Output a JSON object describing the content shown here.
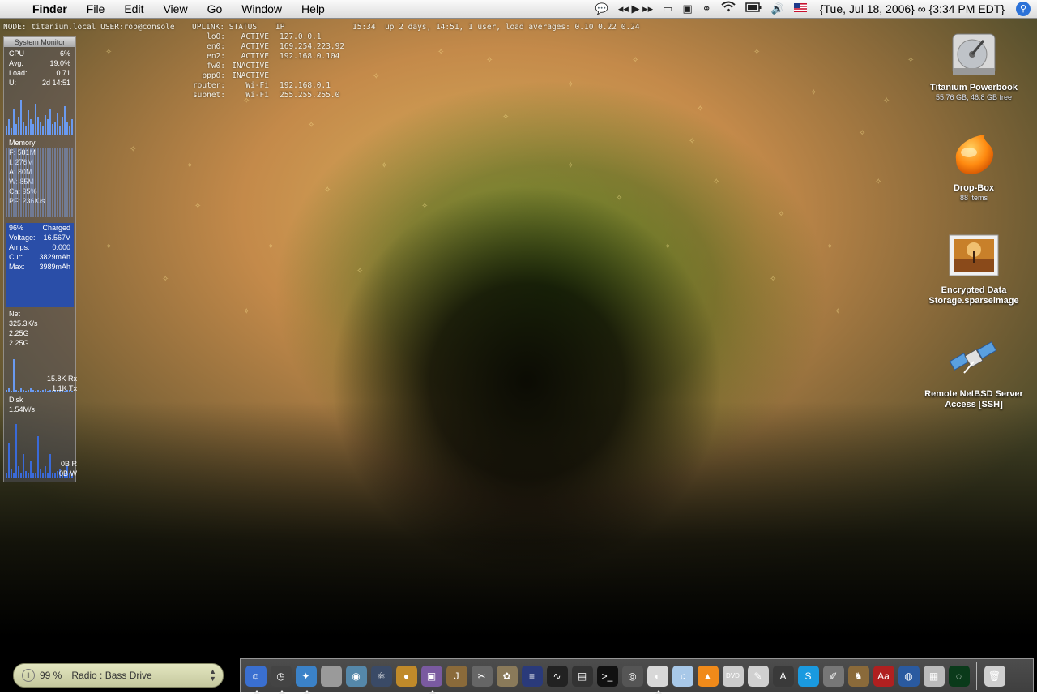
{
  "menubar": {
    "apple_icon": "apple-logo-icon",
    "app_name": "Finder",
    "menus": [
      "File",
      "Edit",
      "View",
      "Go",
      "Window",
      "Help"
    ],
    "status_icons": [
      "chat-icon",
      "media-controls-icon",
      "screen-icon",
      "display-icon",
      "binoculars-icon",
      "wifi-icon",
      "battery-icon",
      "volume-icon",
      "flag-icon"
    ],
    "media_controls": "◂◂ ▶ ▸▸",
    "clock": "{Tue, Jul 18, 2006} ∞ {3:34 PM EDT}"
  },
  "console": {
    "node_line": "NODE: titanium.local USER:rob@console",
    "uplink_header": "UPLINK: STATUS    IP",
    "uptime": "15:34  up 2 days, 14:51, 1 user, load averages: 0.10 0.22 0.24",
    "interfaces": [
      {
        "name": "lo0:",
        "status": "ACTIVE",
        "ip": "127.0.0.1"
      },
      {
        "name": "en0:",
        "status": "ACTIVE",
        "ip": "169.254.223.92"
      },
      {
        "name": "en2:",
        "status": "ACTIVE",
        "ip": "192.168.0.104"
      },
      {
        "name": "fw0:",
        "status": "INACTIVE",
        "ip": ""
      },
      {
        "name": "ppp0:",
        "status": "INACTIVE",
        "ip": ""
      },
      {
        "name": "router:",
        "status": "Wi-Fi",
        "ip": "192.168.0.1"
      },
      {
        "name": "subnet:",
        "status": "Wi-Fi",
        "ip": "255.255.255.0"
      }
    ]
  },
  "sysmon": {
    "title": "System Monitor",
    "cpu": [
      [
        "CPU",
        "6%"
      ],
      [
        "Avg:",
        "19.0%"
      ],
      [
        "Load:",
        "0.71"
      ],
      [
        "U:",
        "2d 14:51"
      ]
    ],
    "memory_title": "Memory",
    "memory": [
      "F: 581M",
      "I: 276M",
      "A: 80M",
      "W: 85M",
      "Ca: 95%",
      "PF: 236K/s"
    ],
    "battery_pct": "96%",
    "battery_state": "Charged",
    "battery": [
      [
        "Voltage:",
        "16.567V"
      ],
      [
        "Amps:",
        "0.000"
      ],
      [
        "Cur:",
        "3829mAh"
      ],
      [
        "Max:",
        "3989mAh"
      ]
    ],
    "net_title": "Net",
    "net": [
      "325.3K/s",
      "2.25G",
      "2.25G"
    ],
    "net_rx": "15.8K Rx",
    "net_tx": "1.1K Tx",
    "disk_title": "Disk",
    "disk_rate": "1.54M/s",
    "disk_read": "0B R",
    "disk_write": "0B W"
  },
  "desktop_icons": [
    {
      "label": "Titanium Powerbook",
      "sub": "55.76 GB, 46.8 GB free",
      "icon": "hard-drive-icon"
    },
    {
      "label": "Drop-Box",
      "sub": "88 items",
      "icon": "dropbox-folder-icon"
    },
    {
      "label": "Encrypted Data Storage.sparseimage",
      "sub": "",
      "icon": "disk-image-icon"
    },
    {
      "label": "Remote NetBSD Server Access [SSH]",
      "sub": "",
      "icon": "satellite-icon"
    }
  ],
  "radio": {
    "volume": "99 %",
    "station": "Radio : Bass Drive"
  },
  "dock": {
    "items": [
      {
        "name": "finder",
        "glyph": "☺",
        "color": "#3a6fd0",
        "running": true
      },
      {
        "name": "dashboard",
        "glyph": "◷",
        "color": "#444",
        "running": true
      },
      {
        "name": "safari",
        "glyph": "✦",
        "color": "#3b82c8",
        "running": true
      },
      {
        "name": "system-prefs",
        "glyph": "",
        "color": "#9a9a9a",
        "running": false
      },
      {
        "name": "eye",
        "glyph": "◉",
        "color": "#5588aa",
        "running": false
      },
      {
        "name": "atom",
        "glyph": "⚛",
        "color": "#3a4a66",
        "running": false
      },
      {
        "name": "burger",
        "glyph": "●",
        "color": "#c08a2a",
        "running": false
      },
      {
        "name": "photo",
        "glyph": "▣",
        "color": "#7a5aa0",
        "running": true
      },
      {
        "name": "journal",
        "glyph": "J",
        "color": "#8a6a3a",
        "running": false
      },
      {
        "name": "utility",
        "glyph": "✂",
        "color": "#666",
        "running": false
      },
      {
        "name": "gimp",
        "glyph": "✿",
        "color": "#8a7a5a",
        "running": false
      },
      {
        "name": "film",
        "glyph": "≡",
        "color": "#2a3a7a",
        "running": false
      },
      {
        "name": "activity",
        "glyph": "∿",
        "color": "#222",
        "running": false
      },
      {
        "name": "console-app",
        "glyph": "▤",
        "color": "#333",
        "running": false
      },
      {
        "name": "terminal",
        "glyph": ">_",
        "color": "#111",
        "running": false
      },
      {
        "name": "spiral",
        "glyph": "◎",
        "color": "#555",
        "running": false
      },
      {
        "name": "ichat",
        "glyph": "◐",
        "color": "#d8d8d8",
        "running": true
      },
      {
        "name": "itunes",
        "glyph": "♫",
        "color": "#a8c8e8",
        "running": false
      },
      {
        "name": "vlc",
        "glyph": "▲",
        "color": "#f08a1a",
        "running": false
      },
      {
        "name": "dvd",
        "glyph": "DVD",
        "color": "#cccccc",
        "running": false
      },
      {
        "name": "preview",
        "glyph": "✎",
        "color": "#d0d0d0",
        "running": false
      },
      {
        "name": "adium",
        "glyph": "A",
        "color": "#3a3a3a",
        "running": false
      },
      {
        "name": "skype",
        "glyph": "S",
        "color": "#1a9ae0",
        "running": false
      },
      {
        "name": "script",
        "glyph": "✐",
        "color": "#777",
        "running": false
      },
      {
        "name": "cat",
        "glyph": "♞",
        "color": "#8a6a3a",
        "running": false
      },
      {
        "name": "dictionary",
        "glyph": "Aa",
        "color": "#b02020",
        "running": false
      },
      {
        "name": "globe",
        "glyph": "◍",
        "color": "#2a5aa0",
        "running": false
      },
      {
        "name": "calculator",
        "glyph": "▦",
        "color": "#bbbbbb",
        "running": false
      },
      {
        "name": "radar",
        "glyph": "◌",
        "color": "#0a3a1a",
        "running": false
      }
    ],
    "trash": {
      "glyph": "🗑",
      "color": "#cfcfcf"
    }
  }
}
